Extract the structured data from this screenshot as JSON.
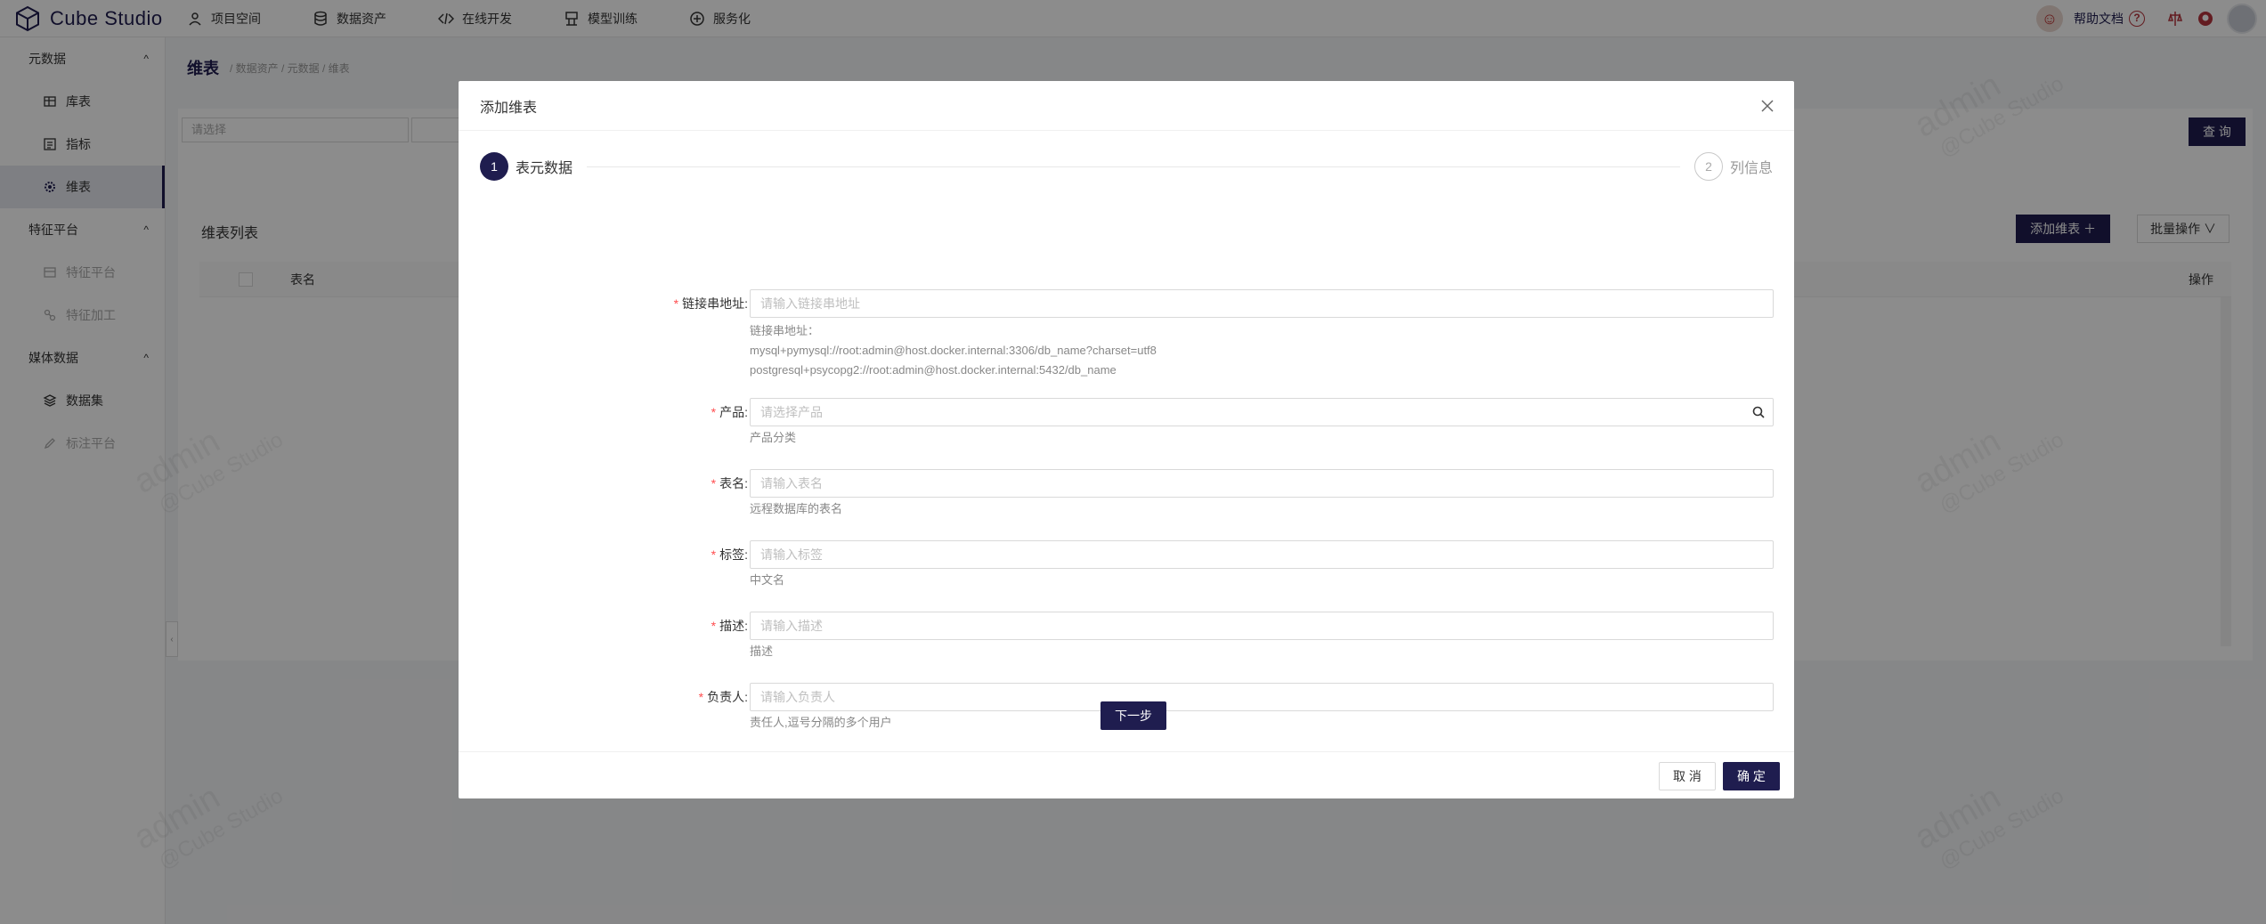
{
  "app": {
    "name": "Cube Studio",
    "logo_icon": "cube-icon"
  },
  "nav": [
    {
      "label": "项目空间",
      "icon": "project-space-icon"
    },
    {
      "label": "数据资产",
      "icon": "database-icon"
    },
    {
      "label": "在线开发",
      "icon": "code-icon"
    },
    {
      "label": "模型训练",
      "icon": "model-train-icon"
    },
    {
      "label": "服务化",
      "icon": "service-icon"
    }
  ],
  "header_right": {
    "help_label": "帮助文档",
    "help_icon": "question-icon"
  },
  "sidebar": {
    "groups": [
      {
        "label": "元数据",
        "chevron": "^",
        "items": [
          {
            "label": "库表"
          },
          {
            "label": "指标"
          },
          {
            "label": "维表"
          }
        ]
      },
      {
        "label": "特征平台",
        "chevron": "^",
        "items": [
          {
            "label": "特征平台"
          },
          {
            "label": "特征加工"
          }
        ]
      },
      {
        "label": "媒体数据",
        "chevron": "^",
        "items": [
          {
            "label": "数据集"
          },
          {
            "label": "标注平台"
          }
        ]
      }
    ]
  },
  "page": {
    "title": "维表",
    "breadcrumb": "/ 数据资产 / 元数据 / 维表",
    "filter_placeholder": "请选择",
    "query_label": "查 询",
    "list_title": "维表列表",
    "add_label": "添加维表 ＋",
    "batch_label": "批量操作 ∨",
    "table_headers": {
      "name": "表名",
      "op": "操作"
    }
  },
  "watermark": {
    "line1": "admin",
    "line2": "@Cube Studio"
  },
  "modal": {
    "title": "添加维表",
    "steps": [
      {
        "num": "1",
        "title": "表元数据",
        "status": "active"
      },
      {
        "num": "2",
        "title": "列信息",
        "status": "wait"
      }
    ],
    "fields": {
      "url": {
        "label": "链接串地址:",
        "placeholder": "请输入链接串地址",
        "help1": "链接串地址：",
        "help2": "mysql+pymysql://root:admin@host.docker.internal:3306/db_name?charset=utf8",
        "help3": "postgresql+psycopg2://root:admin@host.docker.internal:5432/db_name"
      },
      "product": {
        "label": "产品:",
        "placeholder": "请选择产品",
        "help": "产品分类"
      },
      "table": {
        "label": "表名:",
        "placeholder": "请输入表名",
        "help": "远程数据库的表名"
      },
      "tag": {
        "label": "标签:",
        "placeholder": "请输入标签",
        "help": "中文名"
      },
      "desc": {
        "label": "描述:",
        "placeholder": "请输入描述",
        "help": "描述"
      },
      "owner": {
        "label": "负责人:",
        "placeholder": "请输入负责人",
        "help": "责任人,逗号分隔的多个用户"
      }
    },
    "next_label": "下一步",
    "cancel_label": "取 消",
    "ok_label": "确 定"
  },
  "colors": {
    "brand": "#1f1d4f",
    "required": "#ff4d4f"
  }
}
